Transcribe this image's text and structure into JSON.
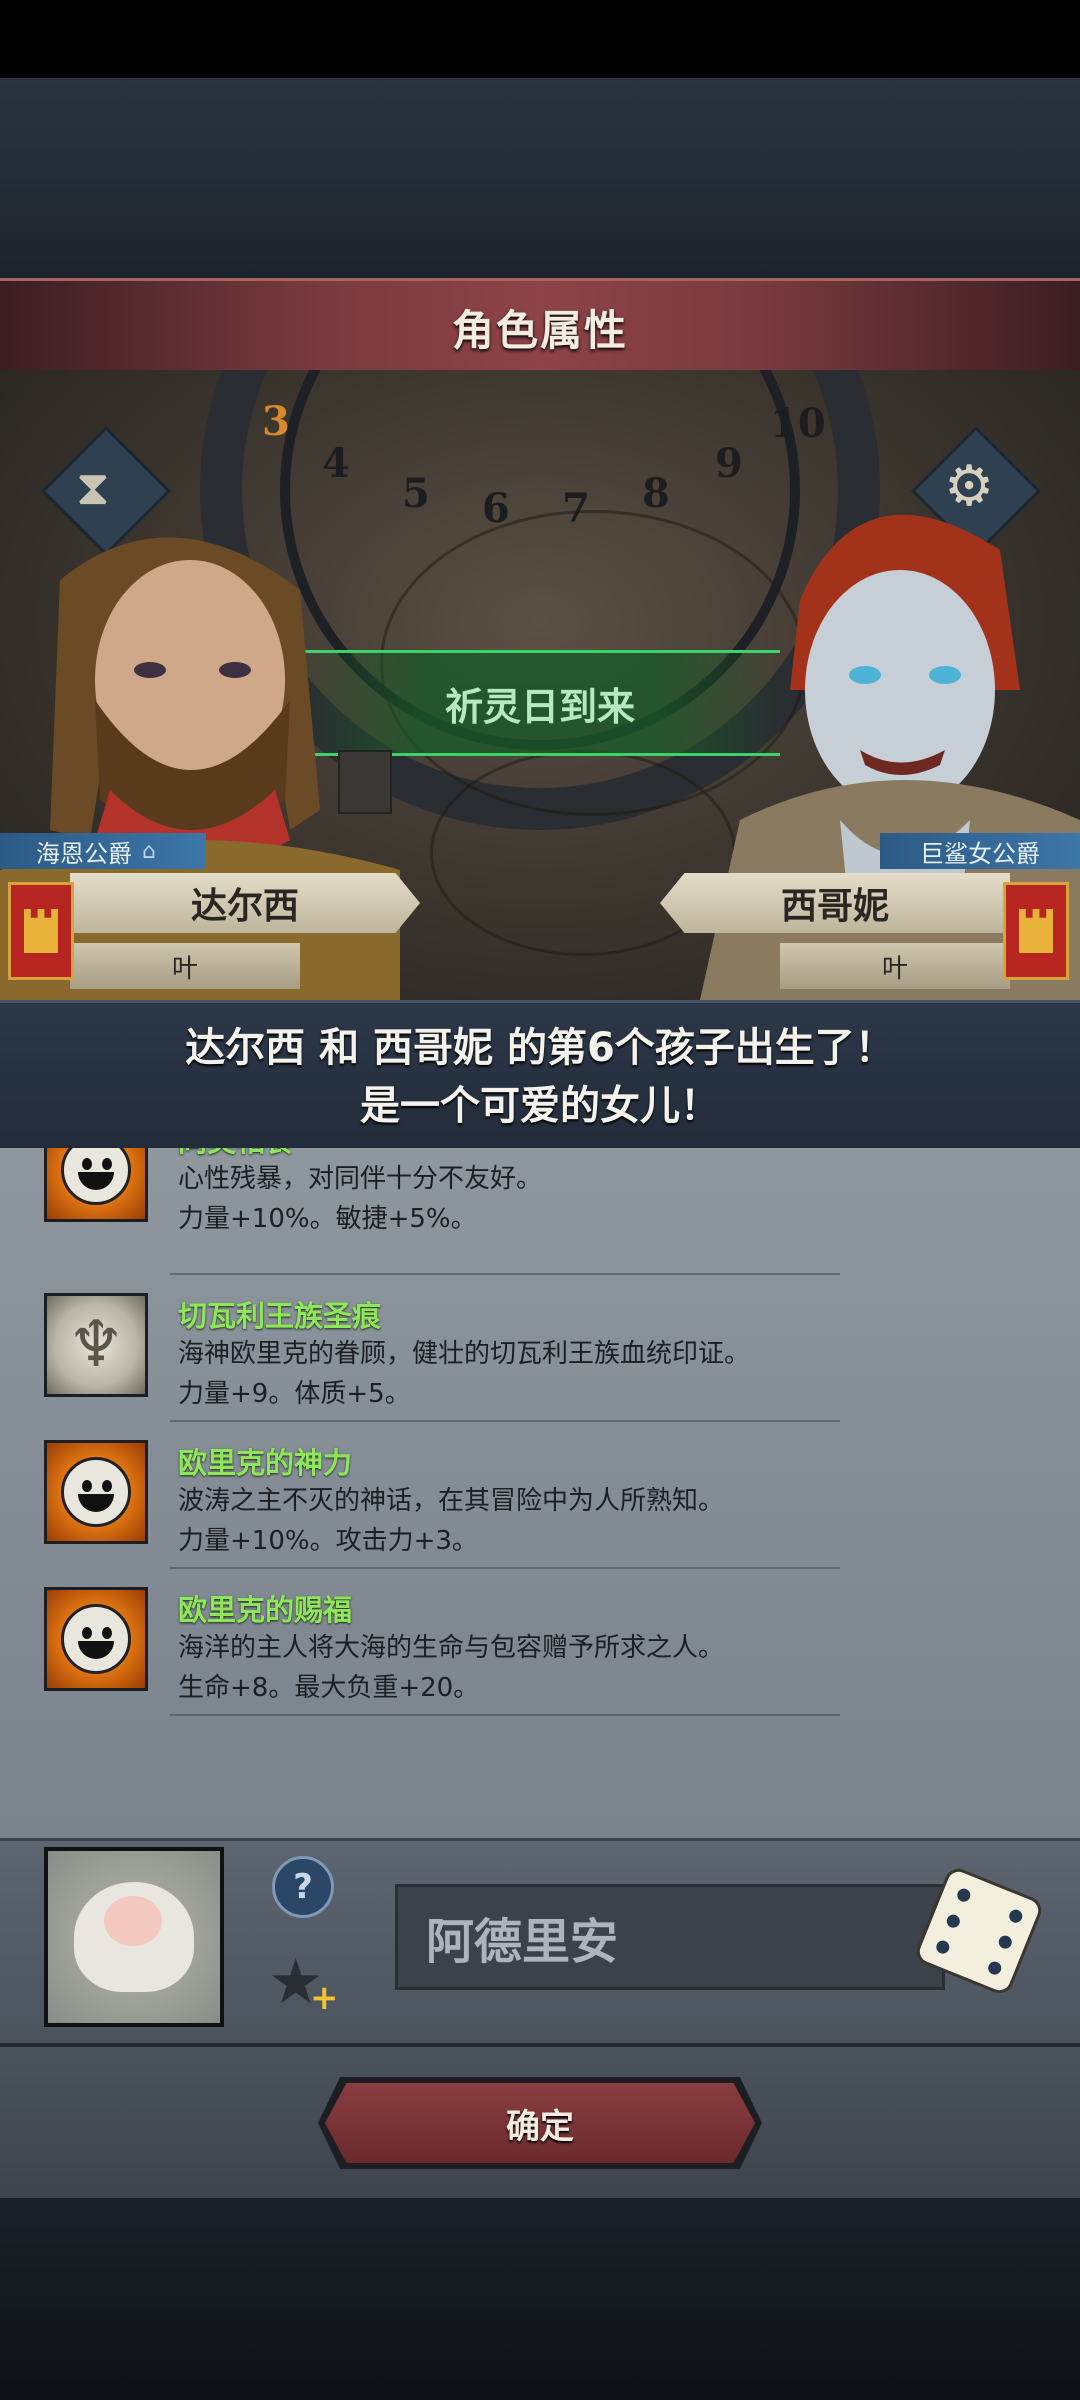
{
  "header": {
    "title": "角色属性"
  },
  "scene": {
    "event_text": "祈灵日到来",
    "wheel_numbers": [
      "4",
      "5",
      "6",
      "7",
      "8",
      "9",
      "10"
    ],
    "highlight_number": "3"
  },
  "left_character": {
    "title": "海恩公爵",
    "name": "达尔西",
    "sub": "叶"
  },
  "right_character": {
    "title": "巨鲨女公爵",
    "name": "西哥妮",
    "sub": "叶"
  },
  "announcement": {
    "line1": "达尔西 和 西哥妮 的第6个孩子出生了！",
    "line2": "是一个可爱的女儿！"
  },
  "traits": [
    {
      "name": "同类相食",
      "desc": "心性残暴，对同伴十分不友好。",
      "stat": "力量+10%。敏捷+5%。",
      "icon": "smiley-sun-icon"
    },
    {
      "name": "切瓦利王族圣痕",
      "desc": "海神欧里克的眷顾，健壮的切瓦利王族血统印证。",
      "stat": "力量+9。体质+5。",
      "icon": "trident-icon"
    },
    {
      "name": "欧里克的神力",
      "desc": "波涛之主不灭的神话，在其冒险中为人所熟知。",
      "stat": "力量+10%。攻击力+3。",
      "icon": "smiley-sun-icon"
    },
    {
      "name": "欧里克的赐福",
      "desc": "海洋的主人将大海的生命与包容赠予所求之人。",
      "stat": "生命+8。最大负重+20。",
      "icon": "smiley-sun-icon"
    }
  ],
  "child": {
    "name_value": "阿德里安",
    "help_label": "?",
    "plus_label": "+"
  },
  "footer": {
    "confirm_label": "确定"
  },
  "colors": {
    "trait_name": "#8fe65a",
    "title_bar": "#8d4348",
    "accent_blue": "#3d76a8"
  }
}
